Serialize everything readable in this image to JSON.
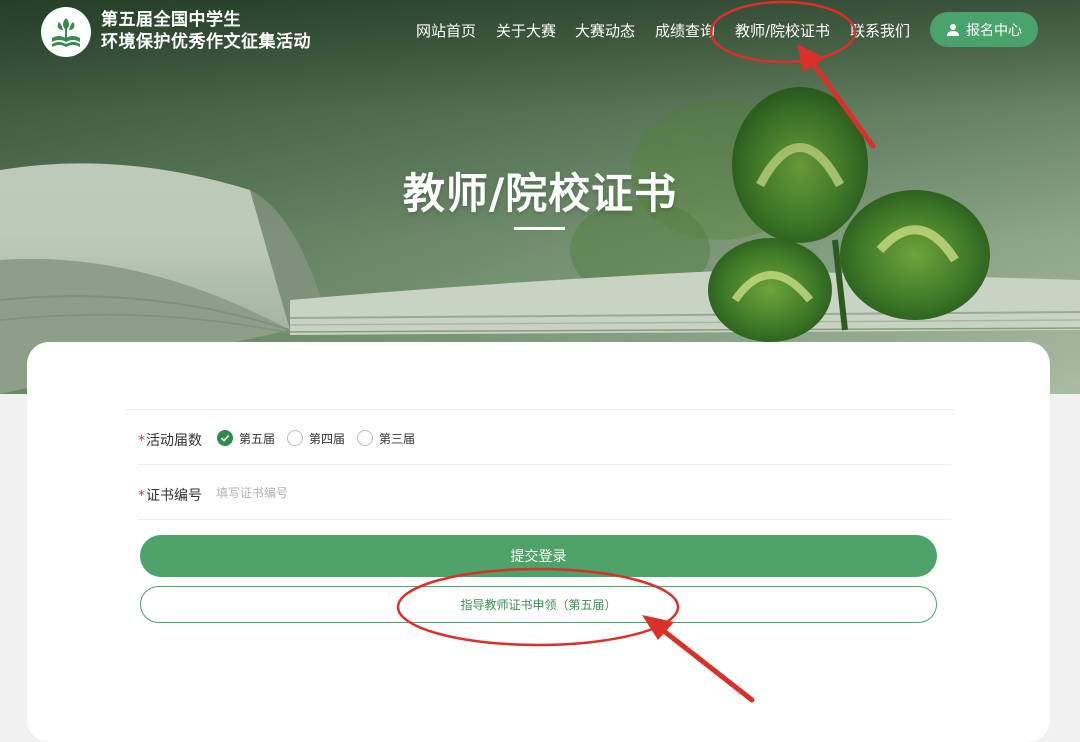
{
  "site": {
    "title_line1": "第五届全国中学生",
    "title_line2": "环境保护优秀作文征集活动"
  },
  "nav": {
    "items": [
      {
        "label": "网站首页"
      },
      {
        "label": "关于大赛"
      },
      {
        "label": "大赛动态"
      },
      {
        "label": "成绩查询"
      },
      {
        "label": "教师/院校证书"
      },
      {
        "label": "联系我们"
      }
    ],
    "register_label": "报名中心",
    "register_icon": "user-icon"
  },
  "hero": {
    "heading": "教师/院校证书"
  },
  "form": {
    "session_label": "活动届数",
    "session_options": [
      {
        "label": "第五届",
        "selected": true
      },
      {
        "label": "第四届",
        "selected": false
      },
      {
        "label": "第三届",
        "selected": false
      }
    ],
    "cert_label": "证书编号",
    "cert_placeholder": "填写证书编号",
    "cert_value": "",
    "required_mark": "*",
    "submit_label": "提交登录",
    "apply_label": "指导教师证书申领（第五届）"
  },
  "colors": {
    "primary_green": "#4ea36a",
    "dark_green": "#2f8a4d",
    "annotation_red": "#d9302a",
    "required_red": "#d83a3a"
  }
}
